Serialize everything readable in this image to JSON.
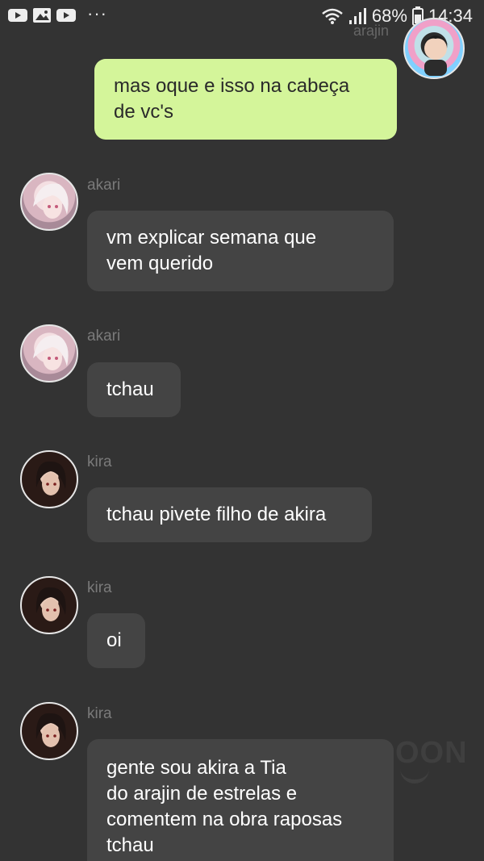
{
  "status_bar": {
    "left_icons": [
      "youtube-icon",
      "gallery-icon",
      "youtube-icon"
    ],
    "overflow": "···",
    "battery_percent": "68%",
    "time": "14:34"
  },
  "messages": [
    {
      "sender": "arajin",
      "text": "mas oque e isso na cabeça\nde vc's",
      "mine": true
    },
    {
      "sender": "akari",
      "text": "vm explicar semana que\nvem querido",
      "mine": false
    },
    {
      "sender": "akari",
      "text": "tchau",
      "mine": false
    },
    {
      "sender": "kira",
      "text": "tchau pivete filho de akira",
      "mine": false
    },
    {
      "sender": "kira",
      "text": "oi",
      "mine": false
    },
    {
      "sender": "kira",
      "text": "gente sou akira a Tia\ndo arajin de estrelas e\ncomentem na obra raposas\ntchau",
      "mine": false
    }
  ],
  "watermark": "OON"
}
